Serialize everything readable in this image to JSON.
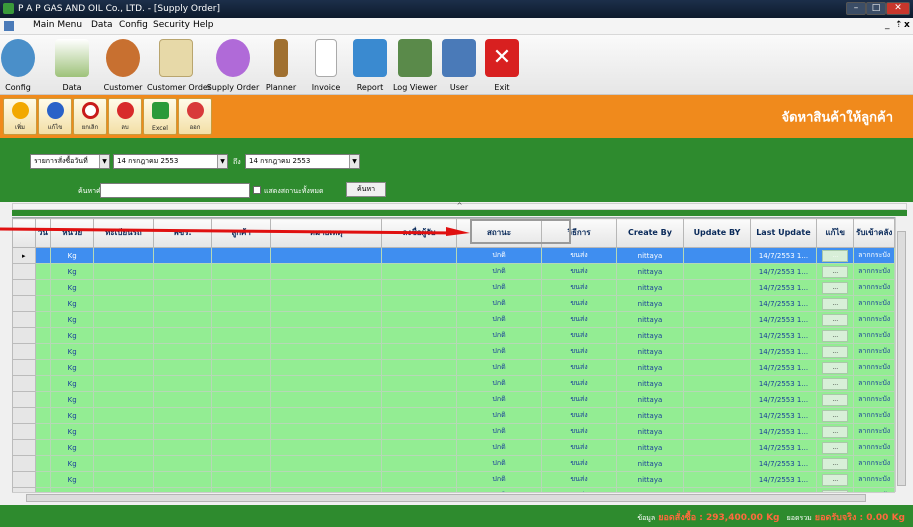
{
  "window": {
    "title": "P A P GAS AND OIL Co., LTD. - [Supply Order]"
  },
  "menu": [
    "Main Menu",
    "Data",
    "Config",
    "Security",
    "Help"
  ],
  "toolbar": [
    {
      "label": "Config",
      "icon": "config-icon",
      "color": "#4a8fc9"
    },
    {
      "label": "Data",
      "icon": "data-icon",
      "color": "#9ec27a"
    },
    {
      "label": "Customer",
      "icon": "customer-icon",
      "color": "#c87030"
    },
    {
      "label": "Customer Order",
      "icon": "customer-order-icon",
      "color": "#e7d9a8"
    },
    {
      "label": "Supply Order",
      "icon": "supply-order-icon",
      "color": "#b06ad8"
    },
    {
      "label": "Planner",
      "icon": "planner-icon",
      "color": "#a07030"
    },
    {
      "label": "Invoice",
      "icon": "invoice-icon",
      "color": "#e8e8e8"
    },
    {
      "label": "Report",
      "icon": "report-icon",
      "color": "#3a8ad0"
    },
    {
      "label": "Log Viewer",
      "icon": "log-viewer-icon",
      "color": "#5a8a4a"
    },
    {
      "label": "User",
      "icon": "user-icon",
      "color": "#4a7ab8"
    },
    {
      "label": "Exit",
      "icon": "exit-icon",
      "color": "#d82020"
    }
  ],
  "actions": [
    {
      "label": "เพิ่ม",
      "icon": "add-icon",
      "color": "#f2a800"
    },
    {
      "label": "แก้ไข",
      "icon": "edit-icon",
      "color": "#2a62c8"
    },
    {
      "label": "ยกเลิก",
      "icon": "cancel-icon",
      "color": "#c81a1a"
    },
    {
      "label": "ลบ",
      "icon": "delete-icon",
      "color": "#d82a2a"
    },
    {
      "label": "Excel",
      "icon": "excel-icon",
      "color": "#2a9a3a"
    },
    {
      "label": "ออก",
      "icon": "close-icon",
      "color": "#d83a3a"
    }
  ],
  "screen_title": "จัดหาสินค้าให้ลูกค้า",
  "filter": {
    "date_type": "รายการสั่งซื้อวันที่",
    "from_date": "14 กรกฎาคม 2553",
    "to_label": "ถึง",
    "to_date": "14 กรกฎาคม 2553",
    "search_label": "ค้นหาคำ",
    "search_value": "",
    "show_all_label": "แสดงสถานะทั้งหมด",
    "search_button": "ค้นหา"
  },
  "splitter_glyph": "^",
  "grid": {
    "columns": [
      "วัน",
      "หน่วย",
      "ทะเบียนรถ",
      "พขร.",
      "ลูกค้า",
      "หมายเหตุ",
      "ลงชื่อผู้รับ",
      "สถานะ",
      "วิธีการ",
      "Create By",
      "Update BY",
      "Last Update",
      "แก้ไข",
      "รับเข้าคลัง"
    ],
    "rows": [
      {
        "unit": "Kg",
        "status": "ปกติ",
        "method": "ขนส่ง",
        "create_by": "nittaya",
        "last_update": "14/7/2553 1...",
        "edit": "...",
        "receive": "ลากกระบัง"
      },
      {
        "unit": "Kg",
        "status": "ปกติ",
        "method": "ขนส่ง",
        "create_by": "nittaya",
        "last_update": "14/7/2553 1...",
        "edit": "...",
        "receive": "ลากกระบัง"
      },
      {
        "unit": "Kg",
        "status": "ปกติ",
        "method": "ขนส่ง",
        "create_by": "nittaya",
        "last_update": "14/7/2553 1...",
        "edit": "...",
        "receive": "ลากกระบัง"
      },
      {
        "unit": "Kg",
        "status": "ปกติ",
        "method": "ขนส่ง",
        "create_by": "nittaya",
        "last_update": "14/7/2553 1...",
        "edit": "...",
        "receive": "ลากกระบัง"
      },
      {
        "unit": "Kg",
        "status": "ปกติ",
        "method": "ขนส่ง",
        "create_by": "nittaya",
        "last_update": "14/7/2553 1...",
        "edit": "...",
        "receive": "ลากกระบัง"
      },
      {
        "unit": "Kg",
        "status": "ปกติ",
        "method": "ขนส่ง",
        "create_by": "nittaya",
        "last_update": "14/7/2553 1...",
        "edit": "...",
        "receive": "ลากกระบัง"
      },
      {
        "unit": "Kg",
        "status": "ปกติ",
        "method": "ขนส่ง",
        "create_by": "nittaya",
        "last_update": "14/7/2553 1...",
        "edit": "...",
        "receive": "ลากกระบัง"
      },
      {
        "unit": "Kg",
        "status": "ปกติ",
        "method": "ขนส่ง",
        "create_by": "nittaya",
        "last_update": "14/7/2553 1...",
        "edit": "...",
        "receive": "ลากกระบัง"
      },
      {
        "unit": "Kg",
        "status": "ปกติ",
        "method": "ขนส่ง",
        "create_by": "nittaya",
        "last_update": "14/7/2553 1...",
        "edit": "...",
        "receive": "ลากกระบัง"
      },
      {
        "unit": "Kg",
        "status": "ปกติ",
        "method": "ขนส่ง",
        "create_by": "nittaya",
        "last_update": "14/7/2553 1...",
        "edit": "...",
        "receive": "ลากกระบัง"
      },
      {
        "unit": "Kg",
        "status": "ปกติ",
        "method": "ขนส่ง",
        "create_by": "nittaya",
        "last_update": "14/7/2553 1...",
        "edit": "...",
        "receive": "ลากกระบัง"
      },
      {
        "unit": "Kg",
        "status": "ปกติ",
        "method": "ขนส่ง",
        "create_by": "nittaya",
        "last_update": "14/7/2553 1...",
        "edit": "...",
        "receive": "ลากกระบัง"
      },
      {
        "unit": "Kg",
        "status": "ปกติ",
        "method": "ขนส่ง",
        "create_by": "nittaya",
        "last_update": "14/7/2553 1...",
        "edit": "...",
        "receive": "ลากกระบัง"
      },
      {
        "unit": "Kg",
        "status": "ปกติ",
        "method": "ขนส่ง",
        "create_by": "nittaya",
        "last_update": "14/7/2553 1...",
        "edit": "...",
        "receive": "ลากกระบัง"
      },
      {
        "unit": "Kg",
        "status": "ปกติ",
        "method": "ขนส่ง",
        "create_by": "nittaya",
        "last_update": "14/7/2553 1...",
        "edit": "...",
        "receive": "ลากกระบัง"
      },
      {
        "unit": "Kg",
        "status": "ปกติ",
        "method": "ขนส่ง",
        "create_by": "nittaya",
        "last_update": "14/7/2553 1...",
        "edit": "...",
        "receive": "ลากกระบัง"
      }
    ]
  },
  "status": {
    "label": "ข้อมูล",
    "ordered": "ยอดสั่งซื้อ : 293,400.00 Kg",
    "sep": "ยอดรวม",
    "received": "ยอดรับจริง : 0.00 Kg"
  }
}
